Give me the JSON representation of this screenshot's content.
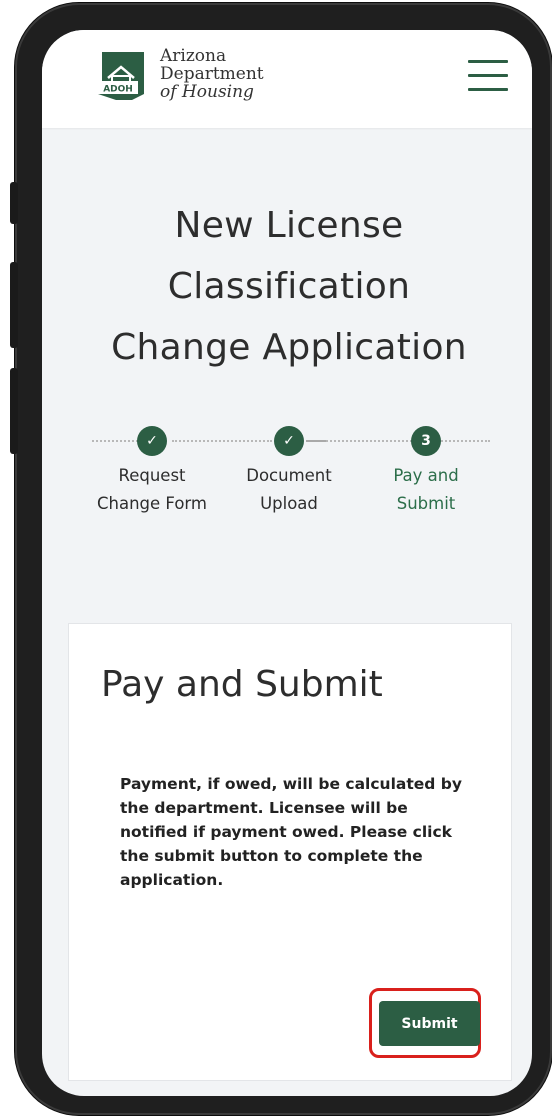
{
  "header": {
    "logo_badge": "ADOH",
    "logo_line1": "Arizona",
    "logo_line2": "Department",
    "logo_line3": "of Housing",
    "menu_icon": "hamburger-menu-icon"
  },
  "page": {
    "title_line1": "New License",
    "title_line2": "Classification",
    "title_line3": "Change Application"
  },
  "stepper": {
    "steps": [
      {
        "line1": "Request",
        "line2": "Change Form",
        "status": "complete",
        "marker": "✓"
      },
      {
        "line1": "Document",
        "line2": "Upload",
        "status": "complete",
        "marker": "✓"
      },
      {
        "line1": "Pay and",
        "line2": "Submit",
        "status": "current",
        "marker": "3"
      }
    ]
  },
  "card": {
    "title": "Pay and Submit",
    "body": "Payment, if owed, will be calculated by the department. Licensee will be notified if payment owed. Please click the submit button to complete the application.",
    "submit_label": "Submit"
  },
  "colors": {
    "brand_green": "#2c5e44",
    "active_step_text": "#2c6e4a",
    "highlight_red": "#d9201c"
  }
}
